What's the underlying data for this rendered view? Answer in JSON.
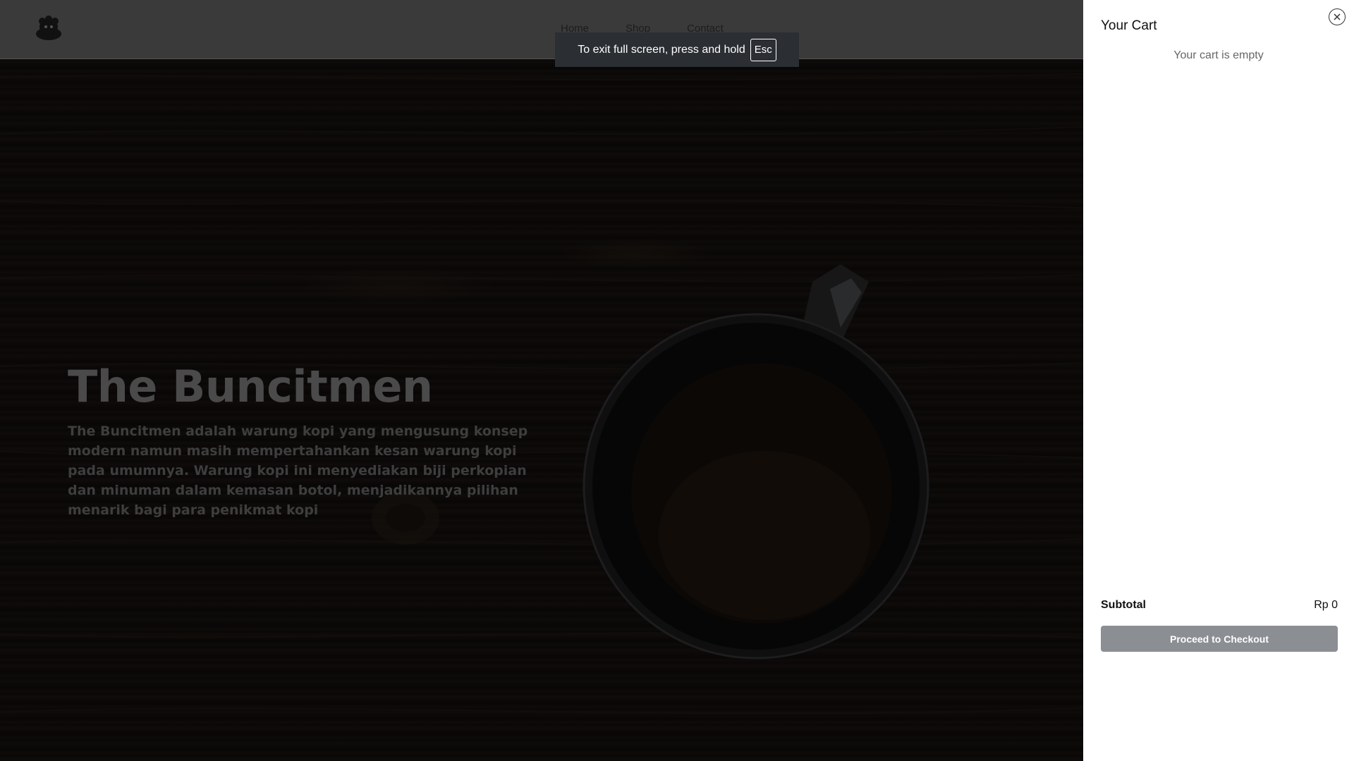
{
  "navbar": {
    "links": [
      {
        "label": "Home"
      },
      {
        "label": "Shop"
      },
      {
        "label": "Contact"
      }
    ]
  },
  "fullscreen_notice": {
    "text": "To exit full screen, press and hold",
    "key": "Esc"
  },
  "hero": {
    "title": "The Buncitmen",
    "description": "The Buncitmen adalah warung kopi yang mengusung konsep modern namun masih mempertahankan kesan warung kopi pada umumnya. Warung kopi ini menyediakan biji perkopian dan minuman dalam kemasan botol, menjadikannya pilihan menarik bagi para penikmat kopi"
  },
  "cart": {
    "title": "Your Cart",
    "empty_message": "Your cart is empty",
    "subtotal_label": "Subtotal",
    "subtotal_value": "Rp 0",
    "checkout_label": "Proceed to Checkout",
    "checkout_color": "#8b8e93"
  },
  "icons": {
    "logo": "coffee-logo-icon",
    "close": "close-icon"
  }
}
